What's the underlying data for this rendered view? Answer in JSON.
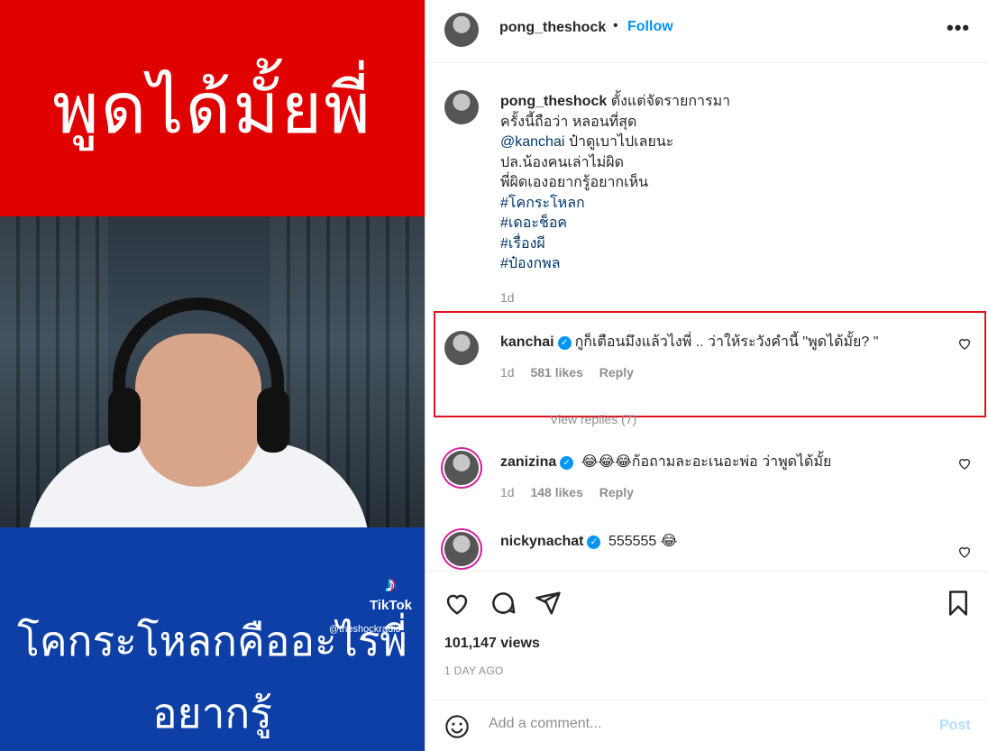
{
  "media": {
    "top_text": "พูดได้มั้ยพี่",
    "bottom_line1": "โคกระโหลกคืออะไรพี่",
    "bottom_line2": "อยากรู้",
    "tiktok_label": "TikTok",
    "tiktok_handle": "@theshockradio",
    "colors": {
      "top_banner": "#e00000",
      "bottom_banner": "#0d3fa6"
    }
  },
  "header": {
    "username": "pong_theshock",
    "separator": "•",
    "follow_label": "Follow",
    "more_icon": "more-horizontal-icon"
  },
  "caption": {
    "username": "pong_theshock",
    "line1": "ตั้งแต่จัดรายการมา",
    "line2": "ครั้งนี้ถือว่า หลอนที่สุด",
    "mention": "@kanchai",
    "line3_rest": " ป๋าดูเบาไปเลยนะ",
    "line4": "ปล.น้องคนเล่าไม่ผิด",
    "line5": "พี่ผิดเองอยากรู้อยากเห็น",
    "hashtags": [
      "#โคกระโหลก",
      "#เดอะช็อค",
      "#เรื่องผี",
      "#ป๋องกพล"
    ],
    "time": "1d"
  },
  "comments": [
    {
      "username": "kanchai",
      "verified": true,
      "text": "กูก็เตือนมึงแล้วไงพี่ .. ว่าให้ระวังคำนี้ \"พูดได้มั้ย? \"",
      "time": "1d",
      "likes": "581 likes",
      "reply": "Reply",
      "view_replies": "View replies (7)"
    },
    {
      "username": "zanizina",
      "verified": true,
      "text": "😂😂😂ก้อถามละอะเนอะพ่อ ว่าพูดได้มั้ย",
      "time": "1d",
      "likes": "148 likes",
      "reply": "Reply"
    },
    {
      "username": "nickynachat",
      "verified": true,
      "text": "555555 😂"
    }
  ],
  "stats": {
    "views": "101,147 views",
    "posted": "1 DAY AGO"
  },
  "add_comment": {
    "placeholder": "Add a comment...",
    "post_label": "Post"
  },
  "colors": {
    "link_blue": "#0095f6",
    "highlight_red": "#e0141e",
    "muted": "#8e8e8e"
  }
}
